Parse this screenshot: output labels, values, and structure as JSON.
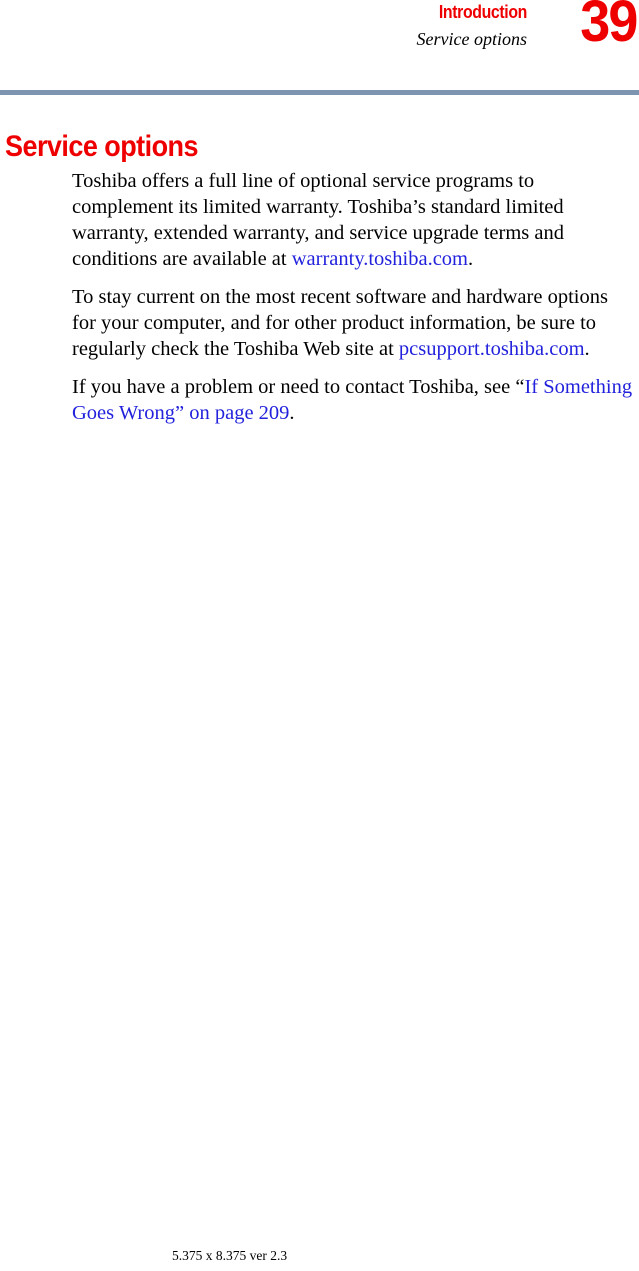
{
  "header": {
    "chapter": "Introduction",
    "section": "Service options",
    "page_number": "39",
    "rule_color": "#7d95b0",
    "accent_color": "#ee0000"
  },
  "section_title": "Service options",
  "body": {
    "paragraphs": [
      {
        "id": "para-service-programs",
        "lead": "Toshiba offers a full line of optional service programs to complement its limited warranty. Toshiba’s standard limited warranty, extended warranty, and service upgrade terms and conditions are available at ",
        "link": "warranty.toshiba.com",
        "tail": "."
      },
      {
        "id": "para-stay-current",
        "lead": "To stay current on the most recent software and hardware options for your computer, and for other product information, be sure to regularly check the Toshiba Web site at ",
        "link": "pcsupport.toshiba.com",
        "tail": "."
      },
      {
        "id": "para-problem-contact",
        "lead": "If you have a problem or need to contact Toshiba, see “",
        "link": "If Something Goes Wrong” on page 209",
        "tail": "."
      }
    ]
  },
  "footer": {
    "spec": "5.375 x 8.375 ver 2.3"
  },
  "colors": {
    "link": "#2222dd",
    "heading": "#ee0000",
    "rule": "#7d95b0",
    "text": "#000000"
  }
}
